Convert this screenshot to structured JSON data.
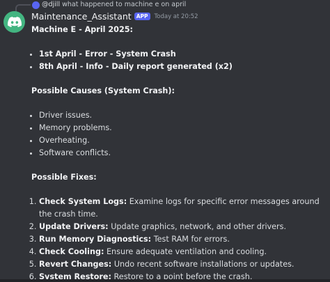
{
  "reply": {
    "username": "@djill",
    "text": "what happened to machine e on april"
  },
  "message": {
    "username": "Maintenance_Assistant",
    "badge": "APP",
    "timestamp": "Today at 20:52",
    "title": "Machine E - April 2025:",
    "events": [
      "1st April - Error - System Crash",
      "8th April - Info - Daily report generated (x2)"
    ],
    "causes_heading": "Possible Causes (System Crash):",
    "causes": [
      "Driver issues.",
      "Memory problems.",
      "Overheating.",
      "Software conflicts."
    ],
    "fixes_heading": "Possible Fixes:",
    "fixes": [
      {
        "title": "Check System Logs:",
        "text": " Examine logs for specific error messages around the crash time."
      },
      {
        "title": "Update Drivers:",
        "text": " Update graphics, network, and other drivers."
      },
      {
        "title": "Run Memory Diagnostics:",
        "text": " Test RAM for errors."
      },
      {
        "title": "Check Cooling:",
        "text": " Ensure adequate ventilation and cooling."
      },
      {
        "title": "Revert Changes:",
        "text": " Undo recent software installations or updates."
      },
      {
        "title": "System Restore:",
        "text": " Restore to a point before the crash."
      }
    ]
  },
  "colors": {
    "background": "#313338",
    "avatar": "#43b581",
    "badge": "#5865f2"
  },
  "icons": {
    "avatar": "discord-logo-icon",
    "reply_avatar": "user-avatar-icon"
  }
}
